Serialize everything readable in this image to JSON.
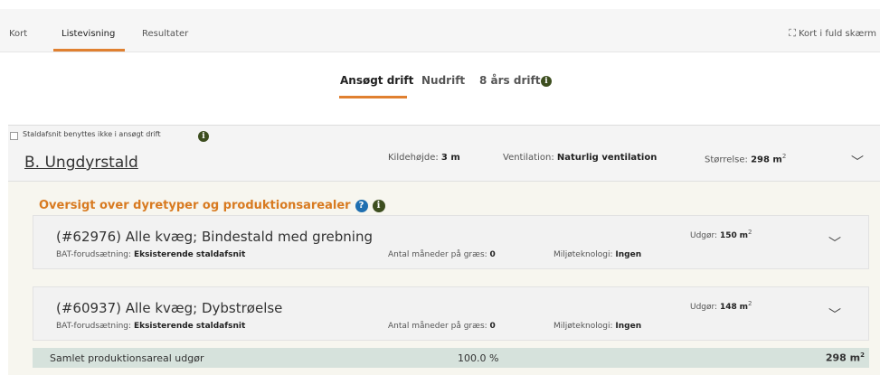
{
  "top_tabs": [
    "Kort",
    "Listevisning",
    "Resultater"
  ],
  "fullscreen_label": "Kort i fuld skærm",
  "drift_tabs": [
    "Ansøgt drift",
    "Nudrift",
    "8 års drift"
  ],
  "stable": {
    "checkbox_label": "Staldafsnit benyttes ikke i ansøgt drift",
    "title": "B. Ungdyrstald",
    "kildehojde_label": "Kildehøjde:",
    "kildehojde_value": "3 m",
    "ventilation_label": "Ventilation:",
    "ventilation_value": "Naturlig ventilation",
    "storrelse_label": "Størrelse:",
    "storrelse_value": "298 m",
    "storrelse_sup": "2"
  },
  "overview_title": "Oversigt over dyretyper og produktionsarealer",
  "animals": [
    {
      "title": "(#62976) Alle kvæg; Bindestald med grebning",
      "bat_label": "BAT-forudsætning:",
      "bat_value": "Eksisterende staldafsnit",
      "graes_label": "Antal måneder på græs:",
      "graes_value": "0",
      "miljo_label": "Miljøteknologi:",
      "miljo_value": "Ingen",
      "udgor_label": "Udgør:",
      "udgor_value": "150",
      "udgor_unit": "m",
      "udgor_sup": "2"
    },
    {
      "title": "(#60937) Alle kvæg; Dybstrøelse",
      "bat_label": "BAT-forudsætning:",
      "bat_value": "Eksisterende staldafsnit",
      "graes_label": "Antal måneder på græs:",
      "graes_value": "0",
      "miljo_label": "Miljøteknologi:",
      "miljo_value": "Ingen",
      "udgor_label": "Udgør:",
      "udgor_value": "148",
      "udgor_unit": "m",
      "udgor_sup": "2"
    }
  ],
  "total": {
    "label": "Samlet produktionsareal udgør",
    "percent": "100.0 %",
    "area": "298 m",
    "area_sup": "2"
  },
  "icons": {
    "info": "i",
    "help": "?",
    "chevron": "﹀",
    "fullscreen": "⛶"
  },
  "colors": {
    "accent": "#e08030",
    "overview": "#d87a20",
    "info_bg": "#3d4e1f",
    "help_bg": "#1f6fb0",
    "total_bg": "#d6e2dc"
  }
}
